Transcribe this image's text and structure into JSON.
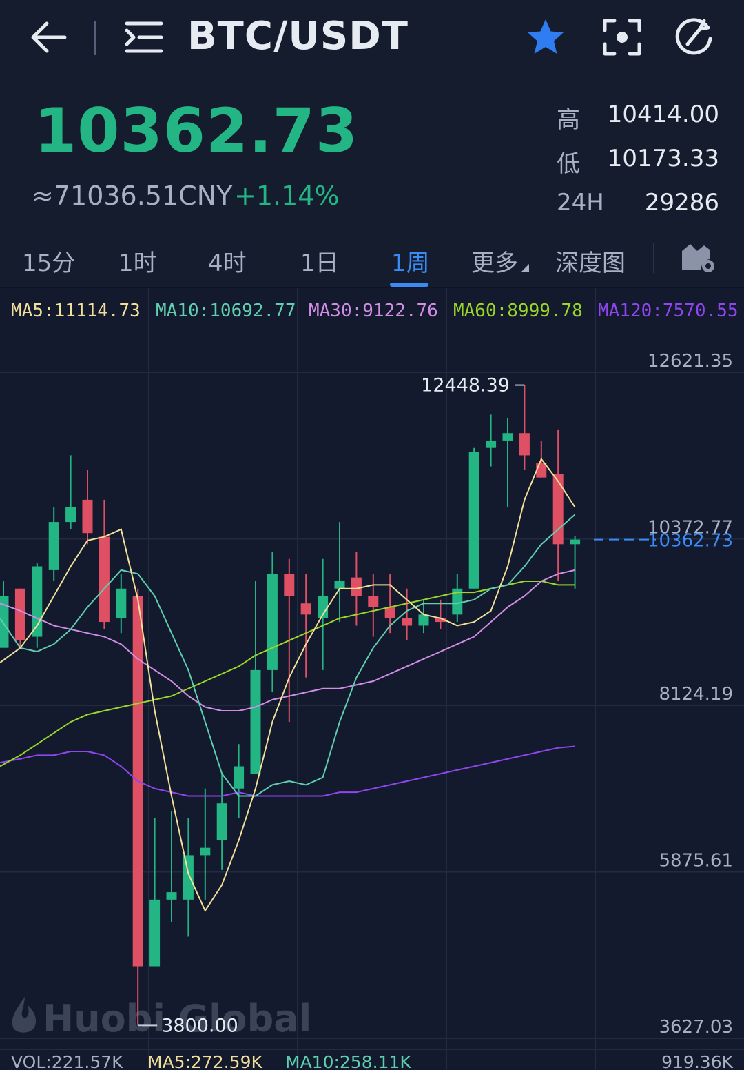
{
  "header": {
    "pair": "BTC/USDT",
    "icons": [
      "arrow-left-icon",
      "list-menu-icon",
      "star-icon",
      "screenshot-icon",
      "refresh-icon"
    ]
  },
  "ticker": {
    "last_price": "10362.73",
    "cny_price": "≈71036.51CNY",
    "change": "+1.14%",
    "high_label": "高",
    "high_value": "10414.00",
    "low_label": "低",
    "low_value": "10173.33",
    "vol_label": "24H",
    "vol_value": "29286"
  },
  "tabs": {
    "items": [
      {
        "label": "15分",
        "active": false
      },
      {
        "label": "1时",
        "active": false
      },
      {
        "label": "4时",
        "active": false
      },
      {
        "label": "1日",
        "active": false
      },
      {
        "label": "1周",
        "active": true
      },
      {
        "label": "更多",
        "active": false
      },
      {
        "label": "深度图",
        "active": false
      }
    ]
  },
  "indicators": {
    "ma5": "MA5:11114.73",
    "ma10": "MA10:10692.77",
    "ma30": "MA30:9122.76",
    "ma60": "MA60:8999.78",
    "ma120": "MA120:7570.55"
  },
  "volume": {
    "vol": "VOL:221.57K",
    "ma5": "MA5:272.59K",
    "ma10": "MA10:258.11K",
    "axis_max": "919.36K"
  },
  "colors": {
    "up": "#23b583",
    "down": "#e05065",
    "ma5": "#f3df9a",
    "ma10": "#5fcfb0",
    "ma30": "#d28ee6",
    "ma60": "#9bd728",
    "ma120": "#8f45f0",
    "accent": "#3b8bf5"
  },
  "watermark": "Huobi Global",
  "chart_data": {
    "type": "candlestick",
    "y_axis_labels": [
      "12621.35",
      "10372.77",
      "8124.19",
      "5875.61",
      "3627.03"
    ],
    "ylim": [
      3627.03,
      12621.35
    ],
    "last_price_label": "10362.73",
    "max_label": "12448.39",
    "min_label": "3800.00",
    "candles": [
      {
        "o": 8900,
        "c": 9600,
        "h": 9800,
        "l": 8900
      },
      {
        "o": 9700,
        "c": 9000,
        "h": 9700,
        "l": 8900
      },
      {
        "o": 9050,
        "c": 10000,
        "h": 10050,
        "l": 8900
      },
      {
        "o": 9950,
        "c": 10600,
        "h": 10800,
        "l": 9800
      },
      {
        "o": 10600,
        "c": 10800,
        "h": 11500,
        "l": 10500
      },
      {
        "o": 10900,
        "c": 10450,
        "h": 11300,
        "l": 10300
      },
      {
        "o": 10400,
        "c": 9250,
        "h": 10900,
        "l": 9150
      },
      {
        "o": 9300,
        "c": 9700,
        "h": 9900,
        "l": 9100
      },
      {
        "o": 9600,
        "c": 4600,
        "h": 9700,
        "l": 3800
      },
      {
        "o": 4600,
        "c": 5500,
        "h": 6600,
        "l": 4800
      },
      {
        "o": 5500,
        "c": 5600,
        "h": 6700,
        "l": 5200
      },
      {
        "o": 5500,
        "c": 6100,
        "h": 6600,
        "l": 5000
      },
      {
        "o": 6100,
        "c": 6200,
        "h": 7000,
        "l": 5500
      },
      {
        "o": 6300,
        "c": 6800,
        "h": 7200,
        "l": 5900
      },
      {
        "o": 7000,
        "c": 7300,
        "h": 7600,
        "l": 6600
      },
      {
        "o": 7200,
        "c": 8600,
        "h": 9800,
        "l": 7200
      },
      {
        "o": 8600,
        "c": 9900,
        "h": 10200,
        "l": 8300
      },
      {
        "o": 9900,
        "c": 9600,
        "h": 10100,
        "l": 7900
      },
      {
        "o": 9500,
        "c": 9350,
        "h": 9900,
        "l": 8500
      },
      {
        "o": 9300,
        "c": 9600,
        "h": 10100,
        "l": 8600
      },
      {
        "o": 9700,
        "c": 9800,
        "h": 10600,
        "l": 9250
      },
      {
        "o": 9850,
        "c": 9600,
        "h": 10200,
        "l": 9200
      },
      {
        "o": 9600,
        "c": 9450,
        "h": 9900,
        "l": 9050
      },
      {
        "o": 9450,
        "c": 9300,
        "h": 9900,
        "l": 9100
      },
      {
        "o": 9300,
        "c": 9200,
        "h": 9700,
        "l": 9000
      },
      {
        "o": 9200,
        "c": 9350,
        "h": 9550,
        "l": 9100
      },
      {
        "o": 9300,
        "c": 9250,
        "h": 9550,
        "l": 9150
      },
      {
        "o": 9350,
        "c": 9700,
        "h": 9900,
        "l": 9250
      },
      {
        "o": 9700,
        "c": 11550,
        "h": 11600,
        "l": 9700
      },
      {
        "o": 11600,
        "c": 11700,
        "h": 12050,
        "l": 11350
      },
      {
        "o": 11700,
        "c": 11800,
        "h": 12000,
        "l": 10800
      },
      {
        "o": 11800,
        "c": 11500,
        "h": 12448.39,
        "l": 11300
      },
      {
        "o": 11400,
        "c": 11200,
        "h": 11700,
        "l": 11200
      },
      {
        "o": 11250,
        "c": 10300,
        "h": 11850,
        "l": 9800
      },
      {
        "o": 10300,
        "c": 10362.73,
        "h": 10414,
        "l": 9700
      }
    ],
    "ma5_series": [
      8700,
      8900,
      9200,
      9600,
      10000,
      10350,
      10400,
      10500,
      9550,
      8050,
      6900,
      5850,
      5350,
      5700,
      6300,
      7000,
      7900,
      8500,
      8950,
      9350,
      9700,
      9700,
      9750,
      9750,
      9550,
      9350,
      9300,
      9200,
      9250,
      9400,
      10000,
      10900,
      11450,
      11150,
      10800
    ],
    "ma10_series": [
      9300,
      8900,
      8850,
      8950,
      9150,
      9450,
      9700,
      9950,
      9900,
      9600,
      9100,
      8600,
      7900,
      7200,
      6900,
      6900,
      7050,
      7100,
      7050,
      7150,
      7900,
      8500,
      8900,
      9200,
      9400,
      9500,
      9500,
      9500,
      9550,
      9700,
      9750,
      10000,
      10300,
      10500,
      10700
    ],
    "ma30_series": [
      9500,
      9400,
      9300,
      9200,
      9150,
      9100,
      9050,
      8950,
      8750,
      8600,
      8450,
      8250,
      8100,
      8050,
      8050,
      8100,
      8200,
      8250,
      8300,
      8350,
      8350,
      8400,
      8450,
      8550,
      8650,
      8750,
      8850,
      8950,
      9050,
      9250,
      9450,
      9600,
      9800,
      9900,
      9950
    ],
    "ma60_series": [
      7300,
      7450,
      7600,
      7750,
      7900,
      8000,
      8050,
      8100,
      8150,
      8200,
      8250,
      8350,
      8450,
      8550,
      8650,
      8800,
      8900,
      9000,
      9100,
      9200,
      9300,
      9350,
      9400,
      9450,
      9500,
      9550,
      9600,
      9650,
      9650,
      9700,
      9750,
      9800,
      9800,
      9750,
      9750
    ],
    "ma120_series": [
      7350,
      7400,
      7450,
      7450,
      7500,
      7500,
      7450,
      7300,
      7100,
      7000,
      6950,
      6900,
      6900,
      6900,
      6950,
      6900,
      6900,
      6900,
      6900,
      6900,
      6950,
      6950,
      7000,
      7050,
      7100,
      7150,
      7200,
      7250,
      7300,
      7350,
      7400,
      7450,
      7500,
      7550,
      7570.55
    ]
  }
}
